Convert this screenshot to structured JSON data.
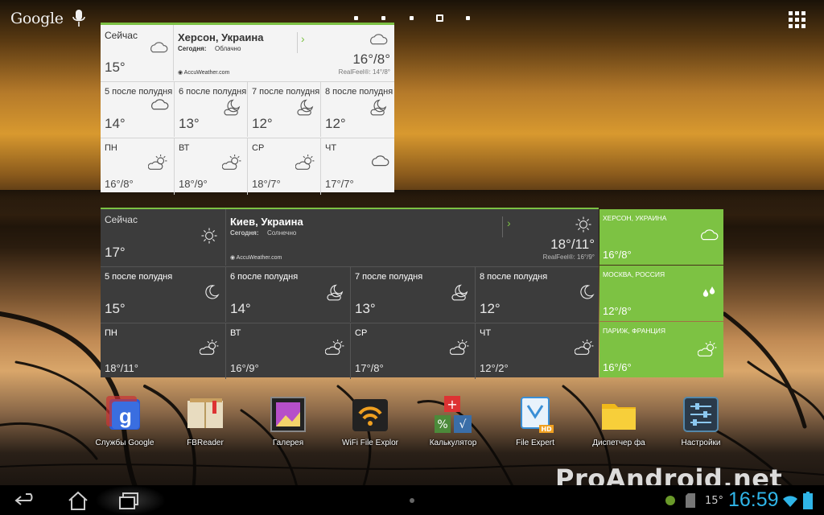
{
  "topbar": {
    "google": "Google"
  },
  "light_widget": {
    "now_label": "Сейчас",
    "now_temp": "15°",
    "city": "Херсон, Украина",
    "today_prefix": "Сегодня:",
    "today_cond": "Облачно",
    "provider": "AccuWeather.com",
    "hi_lo": "16°/8°",
    "realfeel": "RealFeel®: 14°/8°",
    "hours": [
      {
        "label": "5 после полудня",
        "temp": "14°",
        "icon": "cloud-icon"
      },
      {
        "label": "6 после полудня",
        "temp": "13°",
        "icon": "moon-cloud-icon"
      },
      {
        "label": "7 после полудня",
        "temp": "12°",
        "icon": "moon-cloud-icon"
      },
      {
        "label": "8 после полудня",
        "temp": "12°",
        "icon": "moon-cloud-icon"
      }
    ],
    "days": [
      {
        "label": "ПН",
        "temp": "16°/8°",
        "icon": "sun-cloud-icon"
      },
      {
        "label": "ВТ",
        "temp": "18°/9°",
        "icon": "sun-cloud-icon"
      },
      {
        "label": "СР",
        "temp": "18°/7°",
        "icon": "sun-cloud-icon"
      },
      {
        "label": "ЧТ",
        "temp": "17°/7°",
        "icon": "cloud-icon"
      }
    ]
  },
  "dark_widget": {
    "now_label": "Сейчас",
    "now_temp": "17°",
    "city": "Киев, Украина",
    "today_prefix": "Сегодня:",
    "today_cond": "Солнечно",
    "provider": "AccuWeather.com",
    "hi_lo": "18°/11°",
    "realfeel": "RealFeel®: 16°/9°",
    "hours": [
      {
        "label": "5 после полудня",
        "temp": "15°",
        "icon": "moon-icon"
      },
      {
        "label": "6 после полудня",
        "temp": "14°",
        "icon": "moon-cloud-icon"
      },
      {
        "label": "7 после полудня",
        "temp": "13°",
        "icon": "moon-cloud-icon"
      },
      {
        "label": "8 после полудня",
        "temp": "12°",
        "icon": "moon-icon"
      }
    ],
    "days": [
      {
        "label": "ПН",
        "temp": "18°/11°",
        "icon": "sun-cloud-icon"
      },
      {
        "label": "ВТ",
        "temp": "16°/9°",
        "icon": "sun-cloud-icon"
      },
      {
        "label": "СР",
        "temp": "17°/8°",
        "icon": "sun-cloud-icon"
      },
      {
        "label": "ЧТ",
        "temp": "12°/2°",
        "icon": "sun-cloud-icon"
      }
    ]
  },
  "cities": [
    {
      "name": "ХЕРСОН, УКРАИНА",
      "temp": "16°/8°",
      "icon": "cloud-icon"
    },
    {
      "name": "МОСКВА, РОССИЯ",
      "temp": "12°/8°",
      "icon": "rain-drops-icon"
    },
    {
      "name": "ПАРИЖ, ФРАНЦИЯ",
      "temp": "16°/6°",
      "icon": "sun-cloud-icon"
    }
  ],
  "apps": [
    {
      "label": "Службы Google",
      "icon": "google-services-icon"
    },
    {
      "label": "FBReader",
      "icon": "book-icon"
    },
    {
      "label": "Галерея",
      "icon": "gallery-icon"
    },
    {
      "label": "WiFi File Explor",
      "icon": "wifi-icon"
    },
    {
      "label": "Калькулятор",
      "icon": "calculator-icon"
    },
    {
      "label": "File Expert",
      "icon": "file-expert-icon"
    },
    {
      "label": "Диспетчер фа",
      "icon": "folder-icon"
    },
    {
      "label": "Настройки",
      "icon": "settings-icon"
    }
  ],
  "watermark": "ProAndroid.net",
  "status": {
    "temp": "15°",
    "time": "16:59"
  },
  "colors": {
    "accent_green": "#7dc243",
    "clock_blue": "#2fb5e8"
  }
}
